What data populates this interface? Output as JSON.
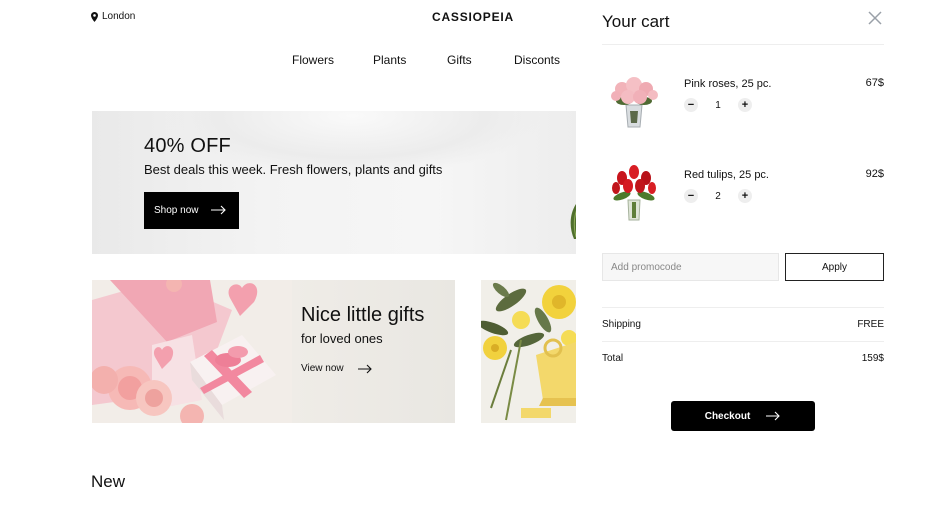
{
  "header": {
    "location": "London",
    "logo": "CASSIOPEIA",
    "nav": [
      "Flowers",
      "Plants",
      "Gifts",
      "Disconts"
    ]
  },
  "hero": {
    "title": "40% OFF",
    "subtitle": "Best deals this week. Fresh flowers, plants and gifts",
    "button_label": "Shop now"
  },
  "gifts_banner": {
    "title": "Nice little gifts",
    "subtitle": "for loved ones",
    "link_label": "View now"
  },
  "section_new": {
    "title": "New"
  },
  "cart": {
    "title": "Your cart",
    "items": [
      {
        "name": "Pink roses, 25 pc.",
        "price": "67$",
        "qty": "1"
      },
      {
        "name": "Red tulips, 25 pc.",
        "price": "92$",
        "qty": "2"
      }
    ],
    "promo_placeholder": "Add promocode",
    "apply_label": "Apply",
    "shipping_label": "Shipping",
    "shipping_value": "FREE",
    "total_label": "Total",
    "total_value": "159$",
    "checkout_label": "Checkout"
  },
  "icons": {
    "location": "map-pin-icon",
    "close": "close-icon",
    "arrow": "arrow-right-icon",
    "minus": "minus-icon",
    "plus": "plus-icon"
  },
  "colors": {
    "primary_button": "#000000",
    "close_icon": "#9aa0a8",
    "divider": "#eeeeee"
  }
}
